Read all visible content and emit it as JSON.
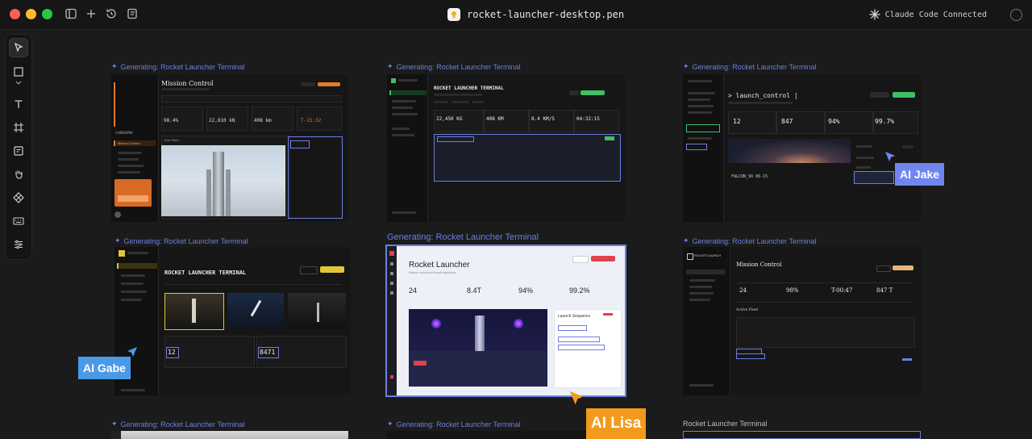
{
  "window": {
    "filename": "rocket-launcher-desktop.pen",
    "status": "Claude Code Connected"
  },
  "toolbar": {
    "tools": [
      "select-tool",
      "rectangle-tool",
      "dropdown-caret",
      "text-tool",
      "frame-tool",
      "note-tool",
      "hand-tool",
      "component-tool",
      "keyboard-tool",
      "settings-sliders-tool"
    ]
  },
  "frames": {
    "generating_label": "Generating: Rocket Launcher Terminal",
    "plain_label": "Rocket Launcher Terminal",
    "f1": {
      "title": "Mission Control",
      "brand": "LAUNCHPAD",
      "nav": [
        "Mission Control"
      ],
      "stats": [
        "98.4%",
        "22,810 kN",
        "408 km",
        "T-15:32"
      ],
      "feed": "Live Feed"
    },
    "f2": {
      "title": "ROCKET LAUNCHER TERMINAL",
      "stats": [
        "22,450 KG",
        "408 KM",
        "8.4 KM/S",
        "04:32:15"
      ]
    },
    "f3": {
      "title": "> launch_control |",
      "stats": [
        "12",
        "847",
        "94%",
        "99.7%"
      ],
      "caption": "FALCON_9X 06-15"
    },
    "f4": {
      "title": "ROCKET LAUNCHER TERMINAL",
      "nums": [
        "12",
        "8471"
      ]
    },
    "f5": {
      "title": "Rocket Launcher",
      "subtitle": "Mission control and launch operations",
      "stats": [
        "24",
        "8.4T",
        "94%",
        "99.2%"
      ],
      "sequence": "Launch Sequence"
    },
    "f6": {
      "title": "Mission Control",
      "brand": "ROCKETLAUNCH",
      "stats": [
        "24",
        "98%",
        "T-00:47",
        "847 T"
      ],
      "section": "Active Fleet"
    }
  },
  "cursors": {
    "jake": {
      "label": "AI Jake",
      "color": "#6f86f0"
    },
    "gabe": {
      "label": "AI Gabe",
      "color": "#4a9ae8"
    },
    "lisa": {
      "label": "AI Lisa",
      "color": "#f39a1e"
    }
  },
  "colors": {
    "accent": "#6d7fe0",
    "orange": "#e27a25",
    "green": "#3fbf63",
    "yellow": "#e3c53a",
    "red": "#e0414d"
  }
}
